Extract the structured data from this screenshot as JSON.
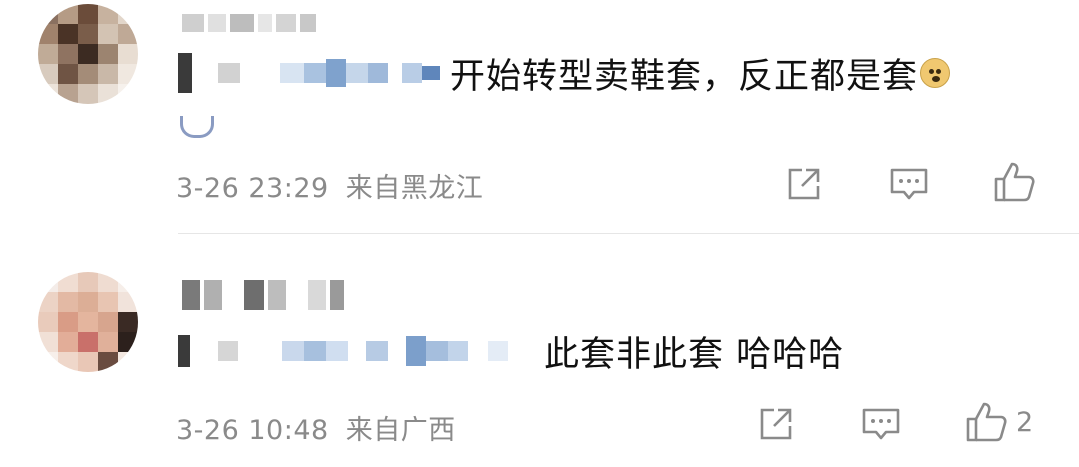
{
  "comments": [
    {
      "text": "开始转型卖鞋套，反正都是套",
      "emoji": "doge-emoji",
      "time": "3-26 23:29",
      "location": "来自黑龙江",
      "likes": ""
    },
    {
      "text": "此套非此套 哈哈哈",
      "time": "3-26 10:48",
      "location": "来自广西",
      "likes": "2"
    }
  ],
  "icons": {
    "share": "share-icon",
    "reply": "comment-icon",
    "like": "thumbs-up-icon"
  },
  "colors": {
    "text": "#111111",
    "meta": "#8a8a8a",
    "divider": "#e6e6e6"
  }
}
